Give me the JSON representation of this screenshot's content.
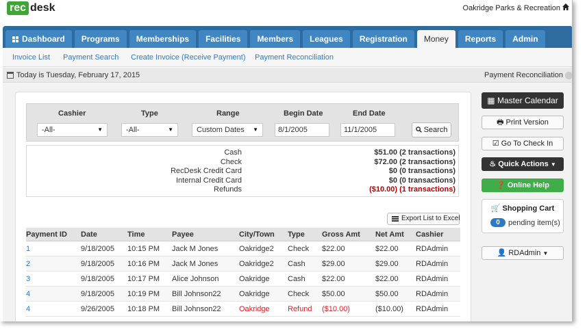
{
  "app": {
    "logo_rec": "rec",
    "logo_desk": "desk",
    "org_name": "Oakridge Parks & Recreation"
  },
  "nav": {
    "tabs": [
      {
        "label": "Dashboard",
        "icon": "grid-icon"
      },
      {
        "label": "Programs"
      },
      {
        "label": "Memberships"
      },
      {
        "label": "Facilities"
      },
      {
        "label": "Members"
      },
      {
        "label": "Leagues"
      },
      {
        "label": "Registration"
      },
      {
        "label": "Money",
        "active": true
      },
      {
        "label": "Reports"
      },
      {
        "label": "Admin"
      }
    ]
  },
  "subnav": [
    "Invoice List",
    "Payment Search",
    "Create Invoice (Receive Payment)",
    "Payment Reconciliation"
  ],
  "datebar": {
    "today": "Today is Tuesday, February 17, 2015",
    "page_title": "Payment Reconciliation"
  },
  "filters": {
    "cashier": {
      "label": "Cashier",
      "value": "-All-"
    },
    "type": {
      "label": "Type",
      "value": "-All-"
    },
    "range": {
      "label": "Range",
      "value": "Custom Dates"
    },
    "begin": {
      "label": "Begin Date",
      "value": "8/1/2005"
    },
    "end": {
      "label": "End Date",
      "value": "11/1/2005"
    },
    "search_label": "Search"
  },
  "summary": [
    {
      "label": "Cash",
      "value": "$51.00 (2 transactions)"
    },
    {
      "label": "Check",
      "value": "$72.00 (2 transactions)"
    },
    {
      "label": "RecDesk Credit Card",
      "value": "$0 (0 transactions)"
    },
    {
      "label": "Internal Credit Card",
      "value": "$0 (0 transactions)"
    },
    {
      "label": "Refunds",
      "value": "($10.00) (1 transactions)",
      "negative": true
    }
  ],
  "export_label": "Export List to Excel",
  "table": {
    "headers": [
      "Payment ID",
      "Date",
      "Time",
      "Payee",
      "City/Town",
      "Type",
      "Gross Amt",
      "Net Amt",
      "Cashier"
    ],
    "rows": [
      [
        "1",
        "9/18/2005",
        "10:15 PM",
        "Jack M Jones",
        "Oakridge2",
        "Check",
        "$22.00",
        "$22.00",
        "RDAdmin"
      ],
      [
        "2",
        "9/18/2005",
        "10:16 PM",
        "Jack M Jones",
        "Oakridge2",
        "Cash",
        "$29.00",
        "$29.00",
        "RDAdmin"
      ],
      [
        "3",
        "9/18/2005",
        "10:17 PM",
        "Alice Johnson",
        "Oakridge",
        "Cash",
        "$22.00",
        "$22.00",
        "RDAdmin"
      ],
      [
        "4",
        "9/18/2005",
        "10:19 PM",
        "Bill Johnson22",
        "Oakridge",
        "Check",
        "$50.00",
        "$50.00",
        "RDAdmin"
      ],
      [
        "4",
        "9/26/2005",
        "10:18 PM",
        "Bill Johnson22",
        "Oakridge",
        "Refund",
        "($10.00)",
        "($10.00)",
        "RDAdmin"
      ]
    ]
  },
  "sidebar": {
    "master_calendar": "Master Calendar",
    "print_version": "Print Version",
    "go_to_check_in": "Go To Check In",
    "quick_actions": "Quick Actions",
    "online_help": "Online Help",
    "cart_title": "Shopping Cart",
    "cart_count": "0",
    "cart_pending": "pending item(s)",
    "user": "RDAdmin"
  }
}
